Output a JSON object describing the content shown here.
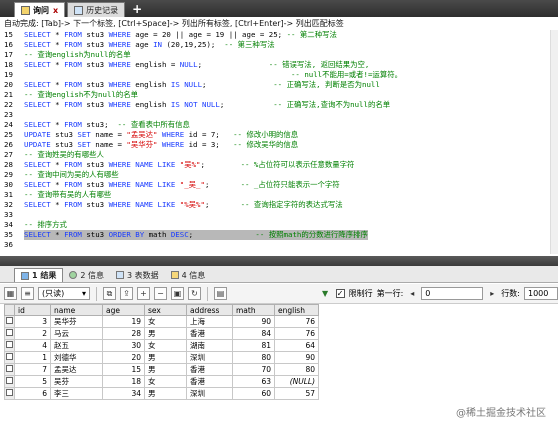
{
  "tabs": [
    {
      "label": "询问",
      "close": "x"
    },
    {
      "label": "历史记录"
    }
  ],
  "tab_add": "+",
  "hint": "自动完成: [Tab]-> 下一个标签, [Ctrl+Space]-> 列出所有标签, [Ctrl+Enter]-> 列出匹配标签",
  "editor_lines": [
    {
      "n": "15",
      "tokens": [
        [
          "kw",
          "SELECT "
        ],
        [
          "txt",
          "* "
        ],
        [
          "kw",
          "FROM "
        ],
        [
          "txt",
          "stu3 "
        ],
        [
          "kw",
          "WHERE "
        ],
        [
          "txt",
          "age = 20 || age = 19 || age = 25; "
        ],
        [
          "cmt",
          "-- 第二种写法"
        ]
      ]
    },
    {
      "n": "16",
      "tokens": [
        [
          "kw",
          "SELECT "
        ],
        [
          "txt",
          "* "
        ],
        [
          "kw",
          "FROM "
        ],
        [
          "txt",
          "stu3 "
        ],
        [
          "kw",
          "WHERE "
        ],
        [
          "txt",
          "age "
        ],
        [
          "kw",
          "IN "
        ],
        [
          "txt",
          "(20,19,25);  "
        ],
        [
          "cmt",
          "-- 第三种写法"
        ]
      ]
    },
    {
      "n": "17",
      "tokens": [
        [
          "cmt",
          "-- 查询english为null的名单"
        ]
      ]
    },
    {
      "n": "18",
      "tokens": [
        [
          "kw",
          "SELECT "
        ],
        [
          "txt",
          "* "
        ],
        [
          "kw",
          "FROM "
        ],
        [
          "txt",
          "stu3 "
        ],
        [
          "kw",
          "WHERE "
        ],
        [
          "txt",
          "english = "
        ],
        [
          "kw",
          "NULL"
        ],
        [
          "txt",
          ";               "
        ],
        [
          "cmt",
          "-- 错误写法, 返回结果为空,"
        ]
      ]
    },
    {
      "n": "19",
      "tokens": [
        [
          "txt",
          "                                                            "
        ],
        [
          "cmt",
          "-- null不能用=或者!=运算符。"
        ]
      ]
    },
    {
      "n": "20",
      "tokens": [
        [
          "kw",
          "SELECT "
        ],
        [
          "txt",
          "* "
        ],
        [
          "kw",
          "FROM "
        ],
        [
          "txt",
          "stu3 "
        ],
        [
          "kw",
          "WHERE "
        ],
        [
          "txt",
          "english "
        ],
        [
          "kw",
          "IS NULL"
        ],
        [
          "txt",
          ";               "
        ],
        [
          "cmt",
          "-- 正确写法, 判断是否为null"
        ]
      ]
    },
    {
      "n": "21",
      "tokens": [
        [
          "cmt",
          "-- 查询english不为null的名单"
        ]
      ]
    },
    {
      "n": "22",
      "tokens": [
        [
          "kw",
          "SELECT "
        ],
        [
          "txt",
          "* "
        ],
        [
          "kw",
          "FROM "
        ],
        [
          "txt",
          "stu3 "
        ],
        [
          "kw",
          "WHERE "
        ],
        [
          "txt",
          "english "
        ],
        [
          "kw",
          "IS NOT NULL"
        ],
        [
          "txt",
          ";           "
        ],
        [
          "cmt",
          "-- 正确写法,查询不为null的名单"
        ]
      ]
    },
    {
      "n": "23",
      "tokens": []
    },
    {
      "n": "24",
      "tokens": [
        [
          "kw",
          "SELECT "
        ],
        [
          "txt",
          "* "
        ],
        [
          "kw",
          "FROM "
        ],
        [
          "txt",
          "stu3;  "
        ],
        [
          "cmt",
          "-- 查看表中所有信息"
        ]
      ]
    },
    {
      "n": "25",
      "tokens": [
        [
          "kw",
          "UPDATE "
        ],
        [
          "txt",
          "stu3 "
        ],
        [
          "kw",
          "SET "
        ],
        [
          "txt",
          "name = "
        ],
        [
          "str",
          "\"孟吴达\""
        ],
        [
          "txt",
          " "
        ],
        [
          "kw",
          "WHERE "
        ],
        [
          "txt",
          "id = 7;   "
        ],
        [
          "cmt",
          "-- 修改小明的信息"
        ]
      ]
    },
    {
      "n": "26",
      "tokens": [
        [
          "kw",
          "UPDATE "
        ],
        [
          "txt",
          "stu3 "
        ],
        [
          "kw",
          "SET "
        ],
        [
          "txt",
          "name = "
        ],
        [
          "str",
          "\"吴华芬\""
        ],
        [
          "txt",
          " "
        ],
        [
          "kw",
          "WHERE "
        ],
        [
          "txt",
          "id = 3;   "
        ],
        [
          "cmt",
          "-- 修改吴华的信息"
        ]
      ]
    },
    {
      "n": "27",
      "tokens": [
        [
          "cmt",
          "-- 查询姓吴的有哪些人"
        ]
      ]
    },
    {
      "n": "28",
      "tokens": [
        [
          "kw",
          "SELECT "
        ],
        [
          "txt",
          "* "
        ],
        [
          "kw",
          "FROM "
        ],
        [
          "txt",
          "stu3 "
        ],
        [
          "kw",
          "WHERE NAME LIKE "
        ],
        [
          "str",
          "\"吴%\""
        ],
        [
          "txt",
          ";        "
        ],
        [
          "cmt",
          "-- %占位符可以表示任意数量字符"
        ]
      ]
    },
    {
      "n": "29",
      "tokens": [
        [
          "cmt",
          "-- 查询中间为吴的人有哪些"
        ]
      ]
    },
    {
      "n": "30",
      "tokens": [
        [
          "kw",
          "SELECT "
        ],
        [
          "txt",
          "* "
        ],
        [
          "kw",
          "FROM "
        ],
        [
          "txt",
          "stu3 "
        ],
        [
          "kw",
          "WHERE NAME LIKE "
        ],
        [
          "str",
          "\"_吴_\""
        ],
        [
          "txt",
          ";       "
        ],
        [
          "cmt",
          "-- _占位符只能表示一个字符"
        ]
      ]
    },
    {
      "n": "31",
      "tokens": [
        [
          "cmt",
          "-- 查询带有吴的人有哪些"
        ]
      ]
    },
    {
      "n": "32",
      "tokens": [
        [
          "kw",
          "SELECT "
        ],
        [
          "txt",
          "* "
        ],
        [
          "kw",
          "FROM "
        ],
        [
          "txt",
          "stu3 "
        ],
        [
          "kw",
          "WHERE NAME LIKE "
        ],
        [
          "str",
          "\"%吴%\""
        ],
        [
          "txt",
          ";       "
        ],
        [
          "cmt",
          "-- 查询指定字符的表达式写法"
        ]
      ]
    },
    {
      "n": "33",
      "tokens": []
    },
    {
      "n": "34",
      "tokens": [
        [
          "cmt",
          "-- 排序方式"
        ]
      ]
    },
    {
      "n": "35",
      "sel": true,
      "tokens": [
        [
          "kw",
          "SELECT "
        ],
        [
          "txt",
          "* "
        ],
        [
          "kw",
          "FROM "
        ],
        [
          "txt",
          "stu3 "
        ],
        [
          "kw",
          "ORDER BY "
        ],
        [
          "txt",
          "math "
        ],
        [
          "kw",
          "DESC"
        ],
        [
          "txt",
          ";              "
        ],
        [
          "cmt",
          "-- 按照math的分数进行降序排序"
        ]
      ]
    },
    {
      "n": "36",
      "tokens": []
    }
  ],
  "result_tabs": [
    {
      "label": "1 结果",
      "active": true
    },
    {
      "label": "2 信息"
    },
    {
      "label": "3 表数据"
    },
    {
      "label": "4 信息"
    }
  ],
  "toolbar": {
    "mode_select": "(只读)",
    "limit_label": "限制行",
    "first_row_label": "第一行:",
    "first_row_value": "0",
    "rows_label": "行数:",
    "rows_value": "1000"
  },
  "grid": {
    "columns": [
      "id",
      "name",
      "age",
      "sex",
      "address",
      "math",
      "english"
    ],
    "rows": [
      [
        "3",
        "吴华芬",
        "19",
        "女",
        "上海",
        "90",
        "76"
      ],
      [
        "2",
        "马云",
        "28",
        "男",
        "香港",
        "84",
        "76"
      ],
      [
        "4",
        "赵五",
        "30",
        "女",
        "湖南",
        "81",
        "64"
      ],
      [
        "1",
        "刘德华",
        "20",
        "男",
        "深圳",
        "80",
        "90"
      ],
      [
        "7",
        "孟吴达",
        "15",
        "男",
        "香港",
        "70",
        "80"
      ],
      [
        "5",
        "吴芬",
        "18",
        "女",
        "香港",
        "63",
        "(NULL)"
      ],
      [
        "6",
        "李三",
        "34",
        "男",
        "深圳",
        "60",
        "57"
      ]
    ]
  },
  "watermark": "@稀土掘金技术社区"
}
